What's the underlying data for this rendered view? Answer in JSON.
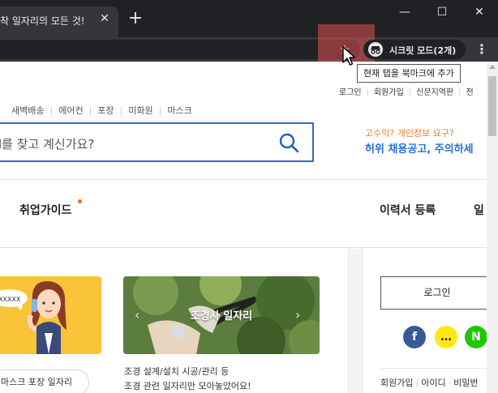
{
  "browser": {
    "tab_title": "착 일자리의 모든 것!",
    "tab_close": "✕",
    "new_tab": "+",
    "minimize": "—",
    "maximize": "☐",
    "close": "✕",
    "bookmark_star": "☆",
    "incognito_label": "시크릿 모드(2개)",
    "menu": "⋮",
    "tooltip": "현재 탭을 북마크에 추가"
  },
  "header": {
    "util_links": [
      "로그인",
      "회원가입",
      "신문지역판",
      "전"
    ],
    "keywords": [
      "새벽배송",
      "에어컨",
      "포장",
      "미화원",
      "마스크"
    ],
    "search_text": "l를 찾고 계신가요?",
    "promo_sub": "고수익? 개인정보 요구?",
    "promo_title": "허위 채용공고, 주의하세"
  },
  "gnb": {
    "guide": "취업가이드",
    "resume": "이력서 등록",
    "more": "일"
  },
  "cards": {
    "card1_speech": "XXXXX",
    "card1_tag": "마스크 포장 일자리",
    "card2_label": "조경사 일자리",
    "card2_desc_1": "조경 설계/설치 시공/관리 등",
    "card2_desc_2": "조경 관련 일자리만 모아놓았어요!"
  },
  "login": {
    "button": "로그인",
    "facebook": "f",
    "kakao": "…",
    "naver": "N",
    "links": [
      "회원가입",
      "아이디",
      "비밀번"
    ]
  },
  "colors": {
    "accent_blue": "#2c6cc8",
    "promo_orange": "#ee7d2a",
    "facebook": "#3b5998",
    "kakao": "#ffe812",
    "naver": "#1ec800"
  }
}
